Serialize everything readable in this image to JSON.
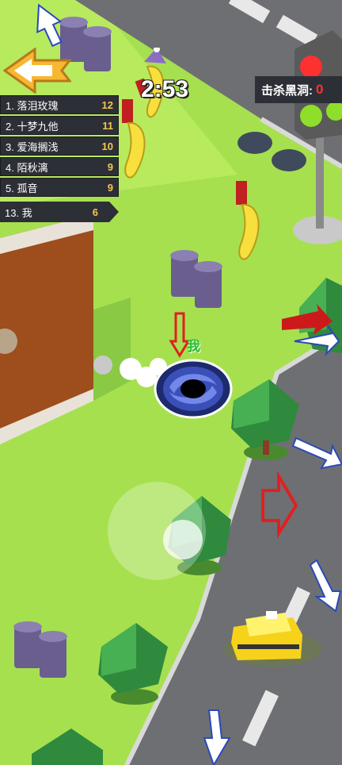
{
  "hud": {
    "timer": "2:53",
    "kill_label": "击杀黑洞:",
    "kill_count": "0",
    "player_label": "我"
  },
  "leaderboard": {
    "rows": [
      {
        "rank_name": "1. 落泪玫瑰",
        "score": "12"
      },
      {
        "rank_name": "2. 十梦九他",
        "score": "11"
      },
      {
        "rank_name": "3. 爱海搁浅",
        "score": "10"
      },
      {
        "rank_name": "4. 陌秋漓",
        "score": "9"
      },
      {
        "rank_name": "5. 孤音",
        "score": "9"
      }
    ],
    "me": {
      "rank_name": "13. 我",
      "score": "6"
    }
  },
  "icons": {
    "back": "back-arrow-icon",
    "hole": "black-hole-icon",
    "traffic_light": "traffic-light-icon"
  },
  "colors": {
    "grass": "#a6e04f",
    "road": "#6e6f73",
    "panel": "#2d2f36",
    "score": "#f5c64a",
    "kill": "#ff3030",
    "player_label": "#22c22e"
  }
}
